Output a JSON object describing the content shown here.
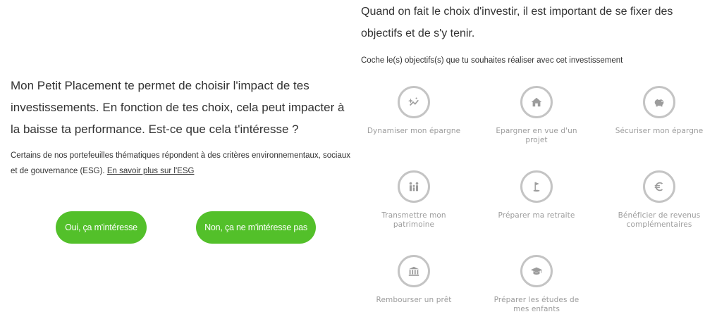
{
  "intro": {
    "question": "Mon Petit Placement te permet de choisir l'impact de tes investissements. En fonction de tes choix, cela peut impacter à la baisse ta performance. Est-ce que cela t'intéresse ?",
    "esg_text": "Certains de nos portefeuilles thématiques répondent à des critères environnementaux, sociaux et de gouvernance (ESG). ",
    "esg_link": "En savoir plus sur l'ESG"
  },
  "buttons": {
    "yes_label": "Oui, ça m'intéresse",
    "no_label": "Non, ça ne m'intéresse pas"
  },
  "goals_section": {
    "headline": "Quand on fait le choix d'investir, il est important de se fixer des objectifs et de s'y tenir.",
    "instruction": "Coche le(s) objectifs(s) que tu souhaites réaliser avec cet investissement",
    "items": [
      {
        "label": "Dynamiser mon épargne",
        "icon": "sparkle-chart-icon"
      },
      {
        "label": "Epargner en vue d'un projet",
        "icon": "house-icon"
      },
      {
        "label": "Sécuriser mon épargne",
        "icon": "piggy-bank-icon"
      },
      {
        "label": "Transmettre mon patrimoine",
        "icon": "family-icon"
      },
      {
        "label": "Préparer ma retraite",
        "icon": "golf-flag-icon"
      },
      {
        "label": "Bénéficier de revenus complémentaires",
        "icon": "euro-icon"
      },
      {
        "label": "Rembourser un prêt",
        "icon": "bank-icon"
      },
      {
        "label": "Préparer les études de mes enfants",
        "icon": "graduation-cap-icon"
      }
    ]
  },
  "colors": {
    "accent_green": "#53c02a",
    "icon_gray": "#9c9c9c",
    "circle_border": "#c4c4c4"
  }
}
